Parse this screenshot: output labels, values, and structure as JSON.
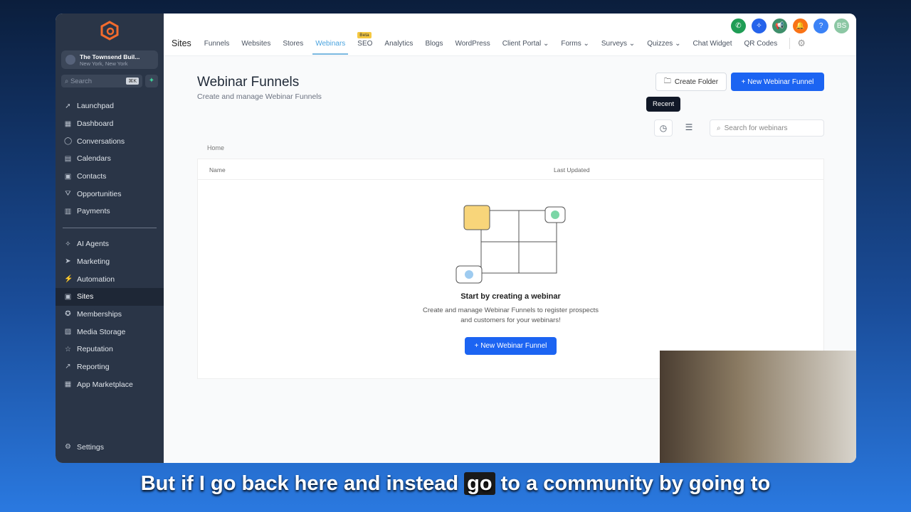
{
  "sidebar": {
    "account_name": "The Townsend Buil...",
    "account_location": "New York, New York",
    "search_placeholder": "Search",
    "search_shortcut": "⌘K",
    "items": [
      {
        "label": "Launchpad",
        "icon": "rocket"
      },
      {
        "label": "Dashboard",
        "icon": "grid"
      },
      {
        "label": "Conversations",
        "icon": "chat"
      },
      {
        "label": "Calendars",
        "icon": "calendar"
      },
      {
        "label": "Contacts",
        "icon": "contact"
      },
      {
        "label": "Opportunities",
        "icon": "funnel"
      },
      {
        "label": "Payments",
        "icon": "receipt"
      }
    ],
    "items2": [
      {
        "label": "AI Agents",
        "icon": "sparkle"
      },
      {
        "label": "Marketing",
        "icon": "send"
      },
      {
        "label": "Automation",
        "icon": "bolt"
      },
      {
        "label": "Sites",
        "icon": "globe"
      },
      {
        "label": "Memberships",
        "icon": "badge"
      },
      {
        "label": "Media Storage",
        "icon": "image"
      },
      {
        "label": "Reputation",
        "icon": "star"
      },
      {
        "label": "Reporting",
        "icon": "trend"
      },
      {
        "label": "App Marketplace",
        "icon": "apps"
      }
    ],
    "settings": "Settings"
  },
  "topnav": {
    "title": "Sites",
    "tabs": [
      "Funnels",
      "Websites",
      "Stores",
      "Webinars",
      "SEO",
      "Analytics",
      "Blogs",
      "WordPress",
      "Client Portal",
      "Forms",
      "Surveys",
      "Quizzes",
      "Chat Widget",
      "QR Codes"
    ],
    "active": "Webinars",
    "beta": "Beta",
    "avatar": "BS",
    "icon_colors": {
      "phone": "#1f9d55",
      "magic": "#2563eb",
      "megaphone": "#3f8f6b",
      "bell": "#f97316",
      "help": "#3b82f6",
      "avatar": "#8cc7a4"
    }
  },
  "page": {
    "title": "Webinar Funnels",
    "subtitle": "Create and manage Webinar Funnels",
    "create_folder": "Create Folder",
    "new_funnel": "+ New Webinar Funnel",
    "tooltip": "Recent",
    "search_placeholder": "Search for webinars",
    "breadcrumb": "Home",
    "col_name": "Name",
    "col_updated": "Last Updated",
    "empty_title": "Start by creating a webinar",
    "empty_line1": "Create and manage Webinar Funnels to register prospects",
    "empty_line2": "and customers for your webinars!",
    "empty_button": "+ New Webinar Funnel"
  },
  "caption": {
    "before": "But if I go back here and instead ",
    "highlight": "go",
    "after": " to a community by going to"
  }
}
